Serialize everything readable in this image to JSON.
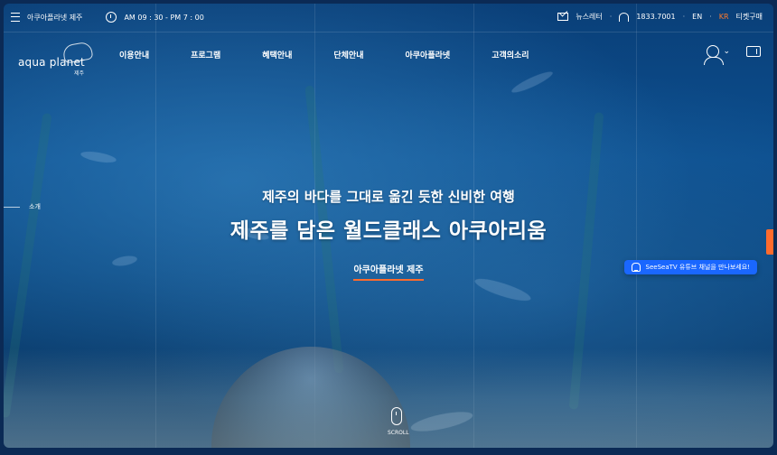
{
  "topbar": {
    "site": "아쿠아플라넷 제주",
    "hours": "AM 09 : 30 - PM 7 : 00",
    "newsletter": "뉴스레터",
    "phone": "1833.7001",
    "lang_en": "EN",
    "lang_kr": "KR",
    "ticket": "티켓구매"
  },
  "logo": {
    "text": "aqua planet",
    "sub": "제주"
  },
  "nav": {
    "items": [
      "이용안내",
      "프로그램",
      "혜택안내",
      "단체안내",
      "아쿠아플라넷",
      "고객의소리"
    ]
  },
  "side": {
    "label": "소개"
  },
  "hero": {
    "subtitle": "제주의 바다를 그대로 옮긴 듯한 신비한 여행",
    "title": "제주를 담은 월드클래스 아쿠아리움",
    "link": "아쿠아플라넷 제주"
  },
  "youtube": {
    "label": "SeeSeaTV 유튜브 채널을 만나보세요!"
  },
  "scroll": {
    "label": "SCROLL"
  },
  "colors": {
    "accent": "#ff6b2d",
    "youtube": "#1a67ff"
  },
  "icons": [
    "menu-icon",
    "clock-icon",
    "mail-icon",
    "phone-icon",
    "user-icon",
    "chevron-down-icon",
    "ticket-icon",
    "bell-icon",
    "mouse-icon"
  ]
}
